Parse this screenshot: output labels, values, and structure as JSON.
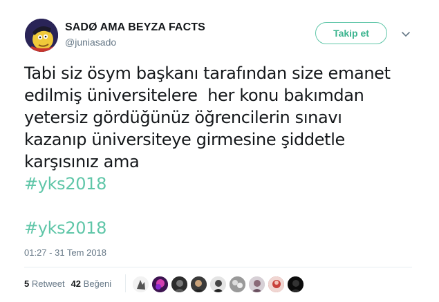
{
  "user": {
    "display_name": "SADØ AMA BEYZA FACTS",
    "handle": "@juniasado"
  },
  "follow_button": {
    "label": "Takip et",
    "color": "#5fc6a8"
  },
  "tweet": {
    "lines": [
      "Tabi siz ösym başkanı tarafından size emanet",
      "edilmiş üniversitelere  her konu bakımdan",
      "yetersiz gördüğünüz öğrencilerin sınavı",
      "kazanıp üniversiteye girmesine şiddetle",
      "karşısınız ama"
    ],
    "hashtags": [
      "#yks2018",
      "#yks2018"
    ],
    "timestamp": "01:27 - 31 Tem 2018"
  },
  "stats": {
    "retweet_count": "5",
    "retweet_label": "Retweet",
    "like_count": "42",
    "like_label": "Beğeni"
  },
  "likers": [
    "avatar-1",
    "avatar-2",
    "avatar-3",
    "avatar-4",
    "avatar-5",
    "avatar-6",
    "avatar-7",
    "avatar-8",
    "avatar-9"
  ]
}
